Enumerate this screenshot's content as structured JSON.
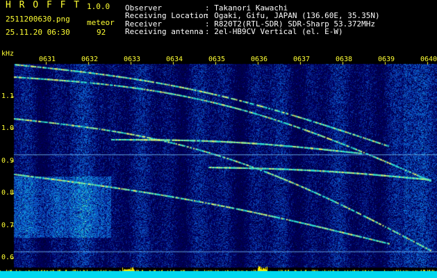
{
  "header": {
    "app_name": "H R O F F T",
    "version": "1.0.0",
    "filename": "2511200630.png",
    "mode": "meteor",
    "timestamp": "25.11.20 06:30",
    "count": "92",
    "info": [
      {
        "label": "Observer",
        "value": ": Takanori Kawachi"
      },
      {
        "label": "Receiving Location",
        "value": ": Ogaki, Gifu, JAPAN (136.60E, 35.35N)"
      },
      {
        "label": "Receiver",
        "value": ": R820T2(RTL-SDR) SDR-Sharp 53.372MHz"
      },
      {
        "label": "Receiving antenna",
        "value": ": 2el-HB9CV Vertical (el. E-W)"
      }
    ]
  },
  "chart_data": {
    "type": "heatmap",
    "ylabel": "kHz",
    "y_ticks": [
      "1.1",
      "1.0",
      "0.9",
      "0.8",
      "0.7",
      "0.6"
    ],
    "x_ticks": [
      "0631",
      "0632",
      "0633",
      "0634",
      "0635",
      "0636",
      "0637",
      "0638",
      "0639",
      "0640"
    ],
    "ylim": [
      0.57,
      1.2
    ],
    "reference_lines_khz": [
      0.92,
      0.62
    ],
    "colors": {
      "background": "#00003a",
      "low": "#0a1a8a",
      "mid": "#1f6fd6",
      "high": "#2ee0d0",
      "peak": "#d8f070",
      "marker": "#ffff33",
      "baseline": "#00e5ff"
    }
  }
}
